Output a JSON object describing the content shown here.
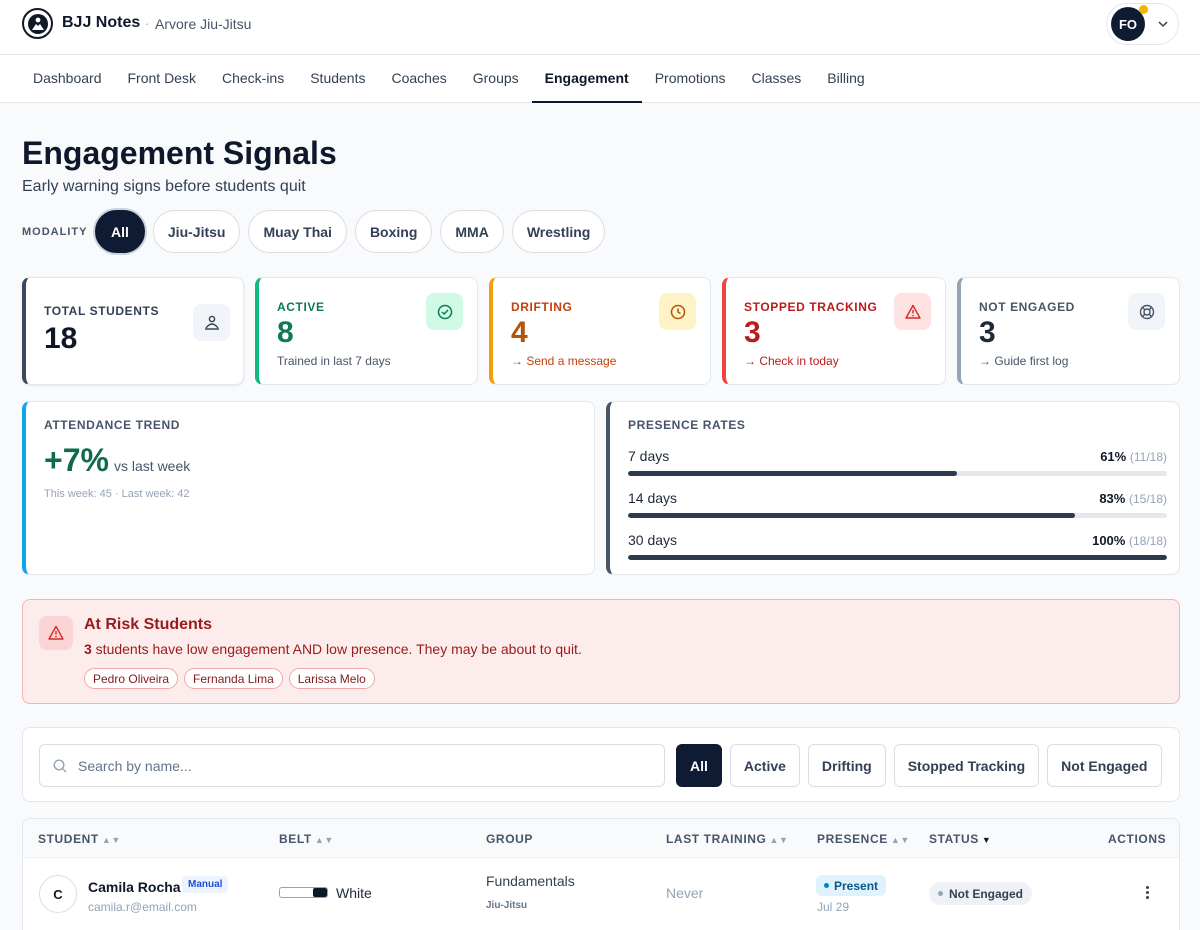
{
  "header": {
    "app_title": "BJJ Notes",
    "separator": "·",
    "gym_name": "Arvore Jiu-Jitsu",
    "user_initials": "FO"
  },
  "nav": {
    "tabs": [
      {
        "label": "Dashboard",
        "active": false
      },
      {
        "label": "Front Desk",
        "active": false
      },
      {
        "label": "Check-ins",
        "active": false
      },
      {
        "label": "Students",
        "active": false
      },
      {
        "label": "Coaches",
        "active": false
      },
      {
        "label": "Groups",
        "active": false
      },
      {
        "label": "Engagement",
        "active": true
      },
      {
        "label": "Promotions",
        "active": false
      },
      {
        "label": "Classes",
        "active": false
      },
      {
        "label": "Billing",
        "active": false
      }
    ]
  },
  "page": {
    "title": "Engagement Signals",
    "subtitle": "Early warning signs before students quit"
  },
  "modality": {
    "label": "MODALITY",
    "options": [
      "All",
      "Jiu-Jitsu",
      "Muay Thai",
      "Boxing",
      "MMA",
      "Wrestling"
    ],
    "selected": "All"
  },
  "stats": {
    "total": {
      "label": "TOTAL STUDENTS",
      "value": "18",
      "icon": "users-icon"
    },
    "active": {
      "label": "ACTIVE",
      "value": "8",
      "note": "Trained in last 7 days",
      "icon": "check-circle-icon",
      "color": "#0f7a5a"
    },
    "drifting": {
      "label": "DRIFTING",
      "value": "4",
      "note": "→ Send a message",
      "icon": "clock-icon",
      "color": "#b45309"
    },
    "stopped": {
      "label": "STOPPED TRACKING",
      "value": "3",
      "note": "→ Check in today",
      "icon": "warning-icon",
      "color": "#b91c1c"
    },
    "not_engaged": {
      "label": "NOT ENGAGED",
      "value": "3",
      "note": "→ Guide first log",
      "icon": "lifebuoy-icon",
      "color": "#1e293b"
    }
  },
  "attendance": {
    "label": "ATTENDANCE TREND",
    "delta": "+7%",
    "comparison": "vs last week",
    "detail": "This week: 45 · Last week: 42"
  },
  "presence": {
    "label": "PRESENCE RATES",
    "rows": [
      {
        "period": "7 days",
        "percent_label": "61%",
        "fraction": "(11/18)",
        "rate": 0.61
      },
      {
        "period": "14 days",
        "percent_label": "83%",
        "fraction": "(15/18)",
        "rate": 0.83
      },
      {
        "period": "30 days",
        "percent_label": "100%",
        "fraction": "(18/18)",
        "rate": 1.0
      }
    ]
  },
  "at_risk": {
    "title": "At Risk Students",
    "count": "3",
    "message": " students have low engagement AND low presence. They may be about to quit.",
    "students": [
      "Pedro Oliveira",
      "Fernanda Lima",
      "Larissa Melo"
    ]
  },
  "filters": {
    "search_placeholder": "Search by name...",
    "options": [
      "All",
      "Active",
      "Drifting",
      "Stopped Tracking",
      "Not Engaged"
    ],
    "selected": "All"
  },
  "table": {
    "columns": {
      "student": "STUDENT",
      "belt": "BELT",
      "group": "GROUP",
      "last_training": "LAST TRAINING",
      "presence": "PRESENCE",
      "status": "STATUS",
      "actions": "ACTIONS"
    },
    "rows": [
      {
        "initial": "C",
        "name": "Camila Rocha",
        "badge": "Manual",
        "email": "camila.r@email.com",
        "belt": "White",
        "group": "Fundamentals",
        "modality": "Jiu-Jitsu",
        "last_training": "Never",
        "presence": "Present",
        "presence_date": "Jul 29",
        "status": "Not Engaged"
      }
    ]
  }
}
